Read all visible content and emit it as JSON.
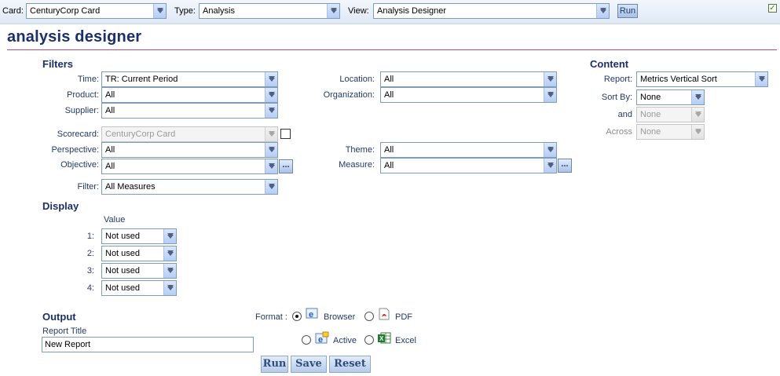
{
  "toolbar": {
    "card_label": "Card:",
    "card_value": "CenturyCorp Card",
    "type_label": "Type:",
    "type_value": "Analysis",
    "view_label": "View:",
    "view_value": "Analysis Designer",
    "run_label": "Run"
  },
  "page": {
    "title": "analysis designer"
  },
  "filters": {
    "heading": "Filters",
    "time": {
      "label": "Time:",
      "value": "TR: Current Period"
    },
    "product": {
      "label": "Product:",
      "value": "All"
    },
    "supplier": {
      "label": "Supplier:",
      "value": "All"
    },
    "location": {
      "label": "Location:",
      "value": "All"
    },
    "organization": {
      "label": "Organization:",
      "value": "All"
    },
    "scorecard": {
      "label": "Scorecard:",
      "value": "CenturyCorp Card"
    },
    "perspective": {
      "label": "Perspective:",
      "value": "All"
    },
    "objective": {
      "label": "Objective:",
      "value": "All"
    },
    "theme": {
      "label": "Theme:",
      "value": "All"
    },
    "measure": {
      "label": "Measure:",
      "value": "All"
    },
    "filter": {
      "label": "Filter:",
      "value": "All Measures"
    },
    "ellipsis": "..."
  },
  "content": {
    "heading": "Content",
    "report": {
      "label": "Report:",
      "value": "Metrics Vertical Sort"
    },
    "sort_by": {
      "label": "Sort By:",
      "value": "None"
    },
    "and": {
      "label": "and",
      "value": "None"
    },
    "across": {
      "label": "Across",
      "value": "None"
    }
  },
  "display": {
    "heading": "Display",
    "column_header": "Value",
    "rows": [
      {
        "label": "1:",
        "value": "Not used"
      },
      {
        "label": "2:",
        "value": "Not used"
      },
      {
        "label": "3:",
        "value": "Not used"
      },
      {
        "label": "4:",
        "value": "Not used"
      }
    ]
  },
  "output": {
    "heading": "Output",
    "report_title_label": "Report Title",
    "report_title_value": "New Report",
    "format_label": "Format :",
    "formats": [
      {
        "label": "Browser",
        "selected": true,
        "icon": "ie-icon"
      },
      {
        "label": "PDF",
        "selected": false,
        "icon": "pdf-icon"
      },
      {
        "label": "Active",
        "selected": false,
        "icon": "ie-active-icon"
      },
      {
        "label": "Excel",
        "selected": false,
        "icon": "excel-icon"
      }
    ]
  },
  "actions": {
    "run": "Run",
    "save": "Save",
    "reset": "Reset"
  }
}
